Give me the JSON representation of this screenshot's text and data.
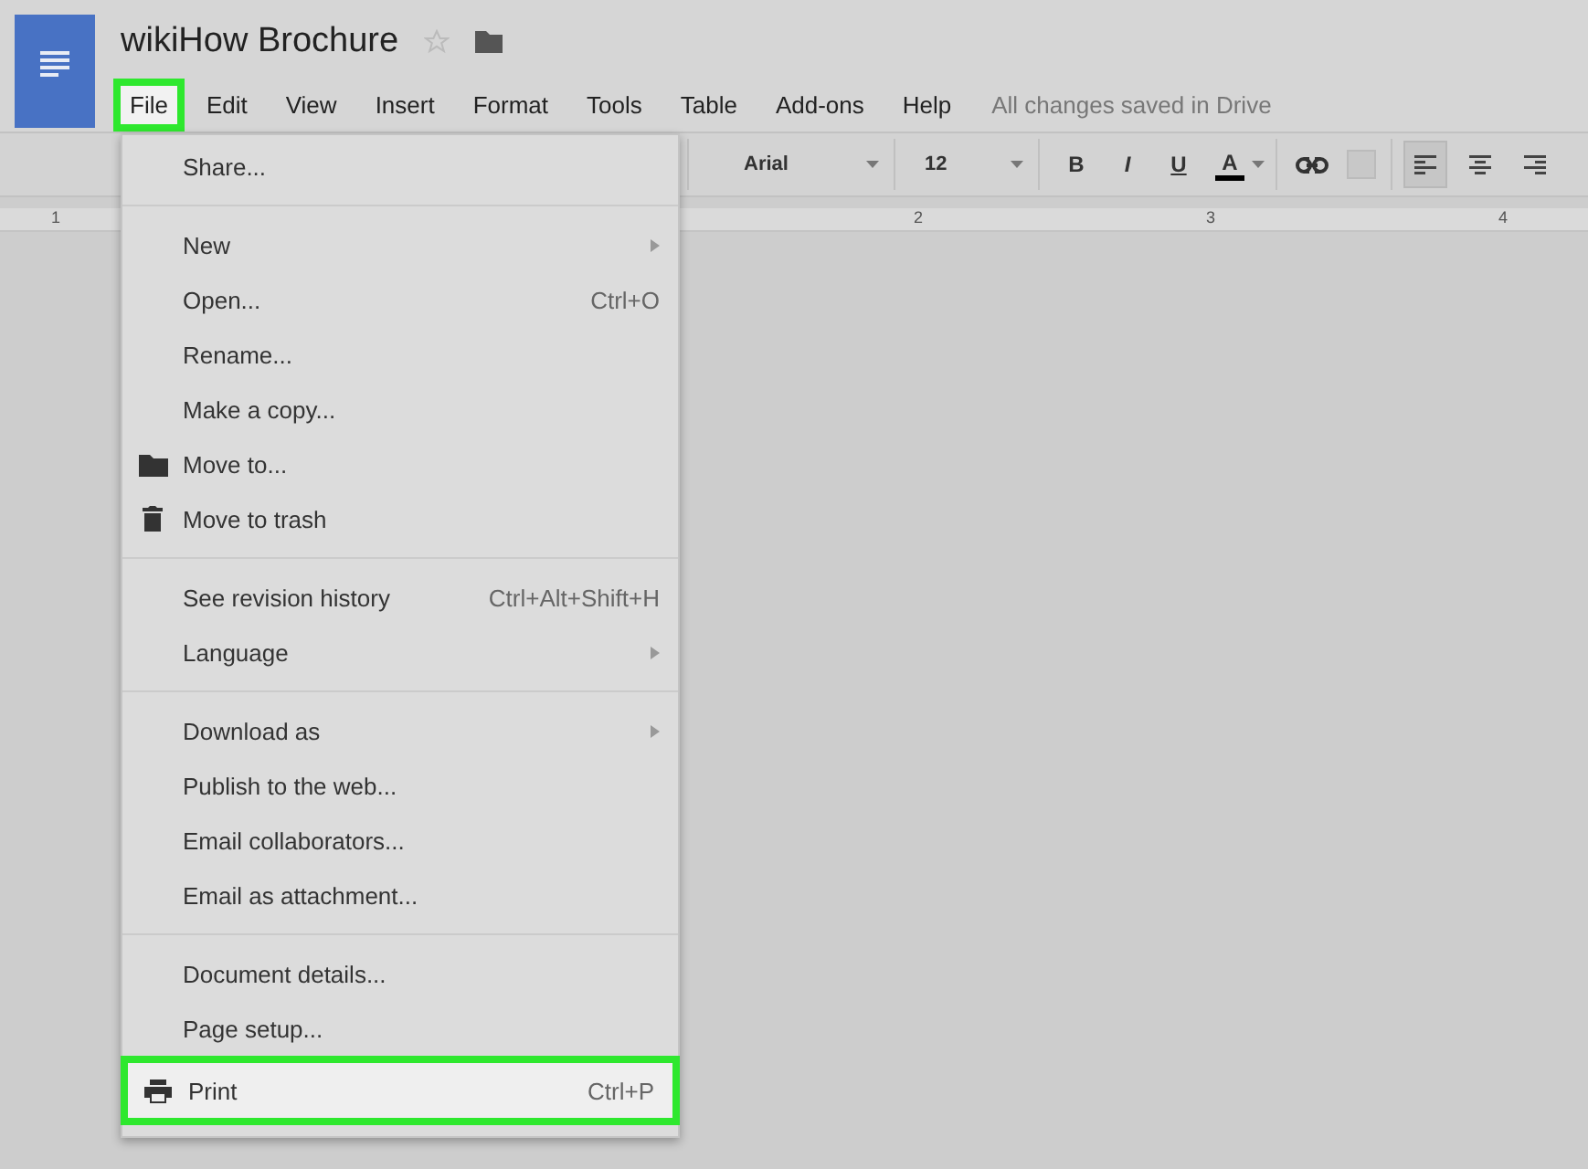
{
  "title": "wikiHow Brochure",
  "starred": false,
  "menubar": [
    {
      "label": "File",
      "selected": true,
      "highlighted": true
    },
    {
      "label": "Edit",
      "selected": false,
      "highlighted": false
    },
    {
      "label": "View",
      "selected": false,
      "highlighted": false
    },
    {
      "label": "Insert",
      "selected": false,
      "highlighted": false
    },
    {
      "label": "Format",
      "selected": false,
      "highlighted": false
    },
    {
      "label": "Tools",
      "selected": false,
      "highlighted": false
    },
    {
      "label": "Table",
      "selected": false,
      "highlighted": false
    },
    {
      "label": "Add-ons",
      "selected": false,
      "highlighted": false
    },
    {
      "label": "Help",
      "selected": false,
      "highlighted": false
    }
  ],
  "save_status": "All changes saved in Drive",
  "toolbar": {
    "font": "Arial",
    "font_size": "12",
    "format_buttons": [
      {
        "kind": "bold",
        "label": "B"
      },
      {
        "kind": "italic",
        "label": "I"
      },
      {
        "kind": "underline",
        "label": "U"
      },
      {
        "kind": "color",
        "label": "A"
      }
    ],
    "align_buttons": [
      {
        "kind": "left",
        "selected": true
      },
      {
        "kind": "center",
        "selected": false
      },
      {
        "kind": "right",
        "selected": false
      }
    ]
  },
  "ruler": {
    "labels": [
      "1",
      "2",
      "3",
      "4"
    ]
  },
  "file_menu": {
    "sections": [
      [
        {
          "label": "Share...",
          "highlighted": false
        }
      ],
      [
        {
          "label": "New",
          "submenu": true,
          "highlighted": false
        },
        {
          "label": "Open...",
          "shortcut": "Ctrl+O",
          "highlighted": false
        },
        {
          "label": "Rename...",
          "highlighted": false
        },
        {
          "label": "Make a copy...",
          "highlighted": false
        },
        {
          "label": "Move to...",
          "kind": "folder",
          "highlighted": false
        },
        {
          "label": "Move to trash",
          "kind": "trash",
          "highlighted": false
        }
      ],
      [
        {
          "label": "See revision history",
          "shortcut": "Ctrl+Alt+Shift+H",
          "highlighted": false
        },
        {
          "label": "Language",
          "submenu": true,
          "highlighted": false
        }
      ],
      [
        {
          "label": "Download as",
          "submenu": true,
          "highlighted": false
        },
        {
          "label": "Publish to the web...",
          "highlighted": false
        },
        {
          "label": "Email collaborators...",
          "highlighted": false
        },
        {
          "label": "Email as attachment...",
          "highlighted": false
        }
      ],
      [
        {
          "label": "Document details...",
          "highlighted": false
        },
        {
          "label": "Page setup...",
          "highlighted": false
        },
        {
          "label": "Print",
          "shortcut": "Ctrl+P",
          "kind": "print",
          "highlighted": true
        }
      ]
    ]
  }
}
